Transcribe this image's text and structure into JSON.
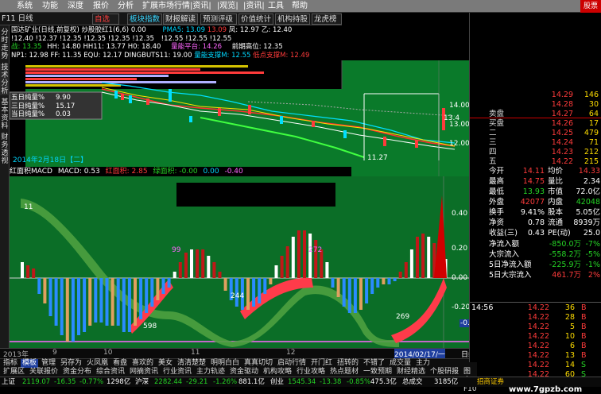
{
  "menubar": {
    "items": [
      "系统",
      "功能",
      "深度",
      "报价",
      "分析",
      "扩展市场行情",
      "|资讯|",
      "|观览|",
      "|资讯|",
      "工具",
      "帮助"
    ],
    "brand": "股票池"
  },
  "toolbar": {
    "items": [
      "F11 日线",
      "自选股",
      "板块指数",
      "财报解读",
      "预测评级",
      "价值统计",
      "机构持股",
      "龙虎榜单"
    ]
  },
  "left_tabs": [
    "分时走势",
    "技术分析",
    "基本资料",
    "财务透视"
  ],
  "stock": {
    "name_line": "国达矿业(日线,前复权)",
    "indicator_name": "炒股胶红1(6,6)",
    "line1": [
      "0.00",
      "!12.55",
      "!12.55",
      "!12.55",
      "!12.55",
      "!12.55",
      "!12.55"
    ],
    "pma_label": "PMA5: 13.09",
    "pma_val2": "13.09",
    "fen_label": "凤: 12.97",
    "yi_label": "乙: 12.40",
    "line2_vals": "!12.40 !12.37 !12.35 !12.35 !12.35 !12.35",
    "zhan_label": "战: 13.35",
    "hh": "HH: 14.80",
    "hh11": "HH11: 13.77",
    "h0": "H0: 18.40",
    "level_label": "量能平台: 14.26",
    "front_high": "前期高位: 12.35",
    "np1": "NP1: 12.98",
    "ff": "FF: 11.35",
    "equ": "EQU: 12.17",
    "dingbuts": "DINGBUTS11: 19.00",
    "support": "量能支撑M: 12.55",
    "low_support": "低点支撑M: 12.49",
    "date_label": "2014年2月18日【二】"
  },
  "legend_box": [
    {
      "label": "五日纯量%",
      "value": "9.90"
    },
    {
      "label": "三日纯量%",
      "value": "15.17"
    },
    {
      "label": "当日纯量%",
      "value": "0.03"
    }
  ],
  "main_axis": [
    "14.00",
    "13.00",
    "12.00"
  ],
  "main_price_marks": [
    "13.4",
    "11.27"
  ],
  "macd": {
    "title": "红面积MACD",
    "macd": "MACD: 0.53",
    "red": "红面积: 2.85",
    "green": "绿面积: -0.00",
    "zero": "0.00",
    "last": "-0.40",
    "labels": [
      "99",
      "272",
      "244",
      "598",
      "269",
      "11"
    ],
    "axis": [
      "0.40",
      "0.20",
      "0.00",
      "-0.20",
      "-0.33"
    ]
  },
  "date_axis": [
    "2013年",
    "9",
    "10",
    "11",
    "12",
    "2014/02/17/一"
  ],
  "period_label": "日线",
  "tabs_row1": [
    "指标",
    "模板",
    "管理",
    "另存为",
    "火凤凰",
    "看盘",
    "喜欢的",
    "美女",
    "清清楚楚",
    "明明白白",
    "真真切切",
    "启动行情",
    "开门红",
    "扭转的",
    "不错了",
    "成交量",
    "主力"
  ],
  "tabs_row2": [
    "扩展区",
    "关联报价",
    "资金分布",
    "综合资讯",
    "网摘资讯",
    "行业资讯",
    "主力轨迹",
    "资金驱动",
    "机构攻略",
    "行业攻略",
    "热点题材",
    "一致预期",
    "财经精选",
    "个股研报",
    "图文F10"
  ],
  "statusbar": {
    "items": [
      "上证",
      "2119.07",
      "-16.35",
      "-0.77%",
      "1298亿",
      "沪深",
      "2282.44",
      "-29.21",
      "-1.26%",
      "881.1亿",
      "创业",
      "1545.34",
      "-13.38",
      "-0.85%",
      "475.3亿",
      "总成交",
      "3185亿",
      "招商证券"
    ]
  },
  "quote": {
    "ask": [
      {
        "lbl": "",
        "price": "14.29",
        "vol": "146"
      },
      {
        "lbl": "",
        "price": "14.28",
        "vol": "30"
      },
      {
        "lbl": "卖盘",
        "price": "14.27",
        "vol": "64"
      }
    ],
    "bid": [
      {
        "lbl": "买盘",
        "price": "14.26",
        "vol": "17"
      },
      {
        "lbl": "二",
        "price": "14.25",
        "vol": "479"
      },
      {
        "lbl": "三",
        "price": "14.24",
        "vol": "71"
      },
      {
        "lbl": "四",
        "price": "14.23",
        "vol": "212"
      },
      {
        "lbl": "五",
        "price": "14.22",
        "vol": "215"
      }
    ],
    "stats": [
      {
        "l1": "今开",
        "v1": "14.11",
        "c1": "red",
        "l2": "均价",
        "v2": "14.33",
        "c2": "red"
      },
      {
        "l1": "最高",
        "v1": "14.75",
        "c1": "red",
        "l2": "量比",
        "v2": "2.34",
        "c2": "white"
      },
      {
        "l1": "最低",
        "v1": "13.93",
        "c1": "green",
        "l2": "市值",
        "v2": "72.0亿",
        "c2": "white"
      },
      {
        "l1": "外盘",
        "v1": "42077",
        "c1": "red",
        "l2": "内盘",
        "v2": "42048",
        "c2": "green"
      },
      {
        "l1": "换手",
        "v1": "9.41%",
        "c1": "white",
        "l2": "股本",
        "v2": "5.05亿",
        "c2": "white"
      },
      {
        "l1": "净资",
        "v1": "0.78",
        "c1": "white",
        "l2": "流通",
        "v2": "8939万",
        "c2": "white"
      },
      {
        "l1": "收益(三)",
        "v1": "0.43",
        "c1": "white",
        "l2": "PE(动)",
        "v2": "25.0",
        "c2": "white"
      }
    ],
    "flows": [
      {
        "lbl": "净流入额",
        "val": "-850.0万",
        "pct": "-7%"
      },
      {
        "lbl": "大宗流入",
        "val": "-558.2万",
        "pct": "-5%"
      },
      {
        "lbl": "5日净流入额",
        "val": "-225.9万",
        "pct": "-1%"
      },
      {
        "lbl": "5日大宗流入",
        "val": "461.7万",
        "pct": "2%"
      }
    ],
    "ticks_time": "14:56",
    "ticks": [
      {
        "p": "14.22",
        "v": "36",
        "s": "B"
      },
      {
        "p": "14.22",
        "v": "28",
        "s": "B"
      },
      {
        "p": "14.22",
        "v": "5",
        "s": "B"
      },
      {
        "p": "14.22",
        "v": "10",
        "s": "B"
      },
      {
        "p": "14.22",
        "v": "6",
        "s": "B"
      },
      {
        "p": "14.22",
        "v": "13",
        "s": "B"
      },
      {
        "p": "14.22",
        "v": "14",
        "s": "S"
      },
      {
        "p": "14.22",
        "v": "60",
        "s": "S"
      }
    ]
  },
  "watermark": "www.7gpzb.com"
}
